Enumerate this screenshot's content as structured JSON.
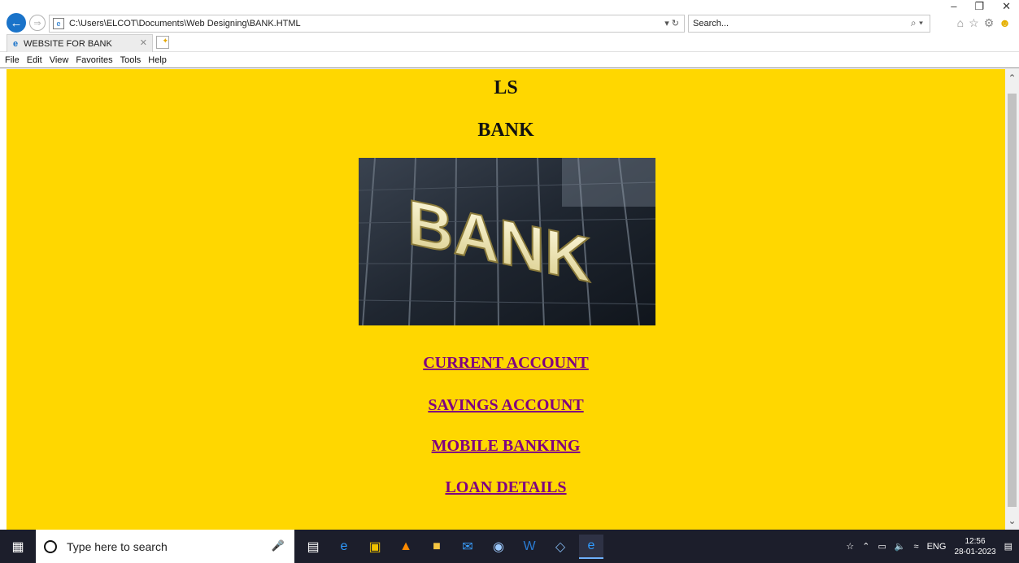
{
  "browser": {
    "address_url": "C:\\Users\\ELCOT\\Documents\\Web Designing\\BANK.HTML",
    "search_placeholder": "Search...",
    "tab_title": "WEBSITE FOR BANK",
    "menu": [
      "File",
      "Edit",
      "View",
      "Favorites",
      "Tools",
      "Help"
    ]
  },
  "page": {
    "background_color": "#ffd700",
    "link_color": "#800080",
    "heading_line1": "LS",
    "heading_line2": "BANK",
    "image_text": "BANK",
    "links": [
      {
        "label": "CURRENT ACCOUNT"
      },
      {
        "label": "SAVINGS ACCOUNT"
      },
      {
        "label": "MOBILE BANKING"
      },
      {
        "label": "LOAN DETAILS"
      }
    ]
  },
  "taskbar": {
    "search_placeholder": "Type here to search",
    "language": "ENG",
    "time": "12:56",
    "date": "28-01-2023"
  }
}
